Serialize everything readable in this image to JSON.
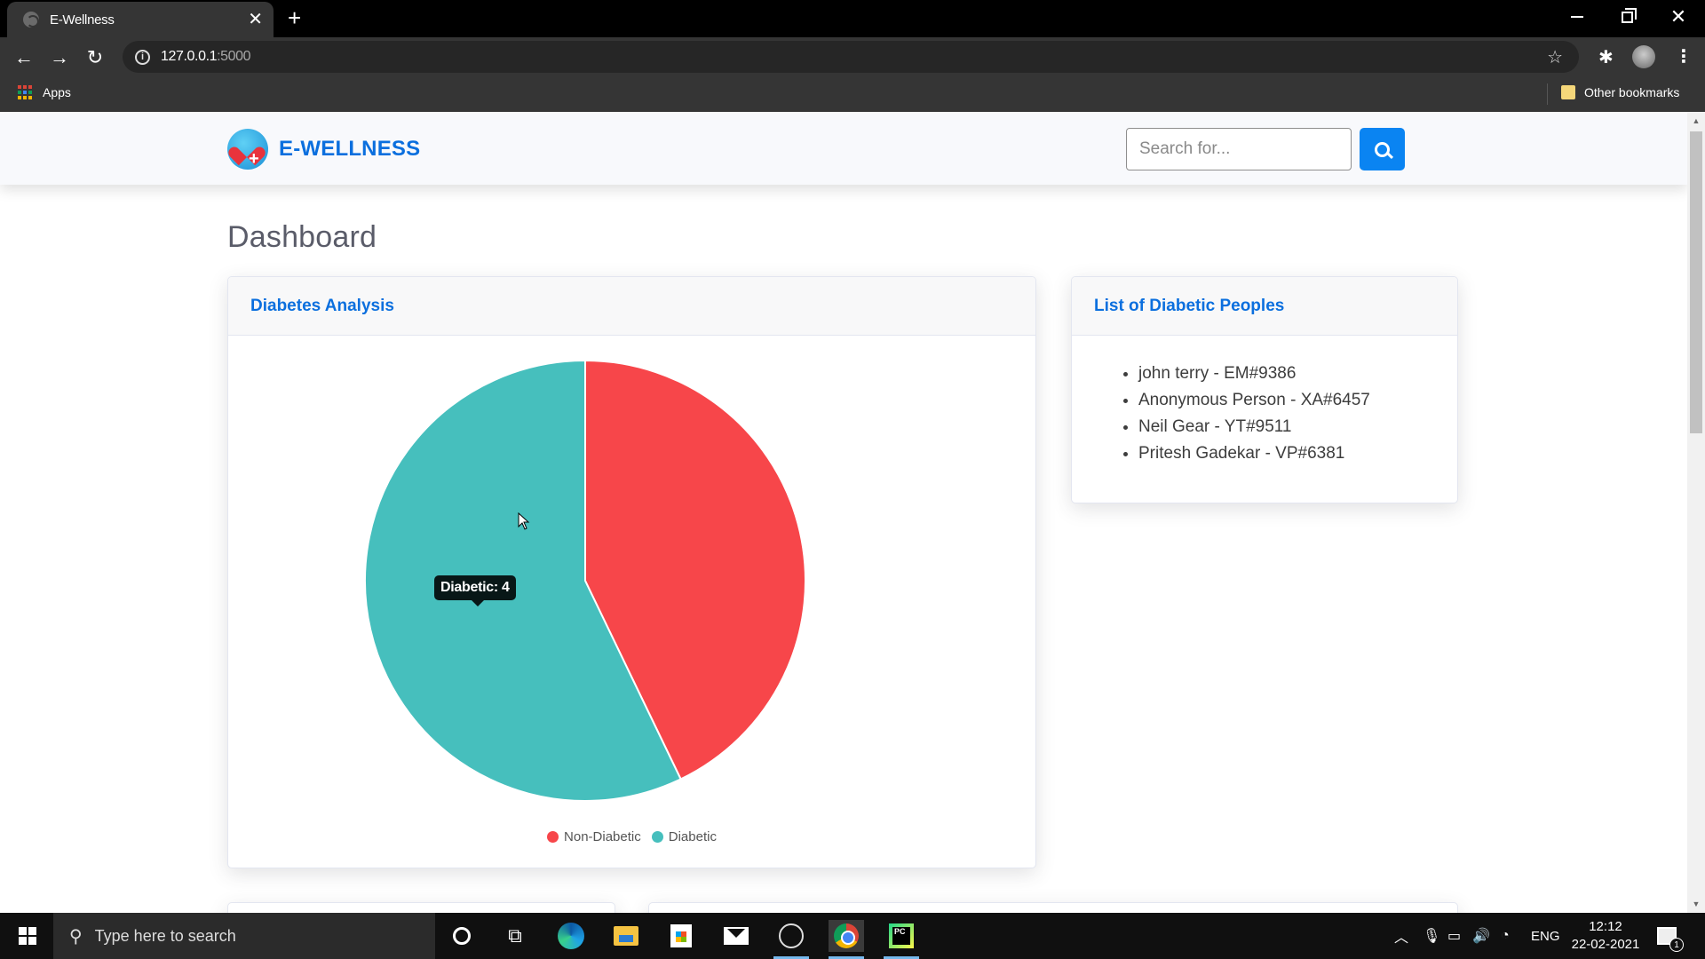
{
  "browser": {
    "tab_title": "E-Wellness",
    "new_tab_symbol": "+",
    "close_tab_symbol": "✕",
    "url_host": "127.0.0.1",
    "url_port": ":5000",
    "bookmarks": {
      "apps_label": "Apps",
      "other_label": "Other bookmarks"
    },
    "icons": {
      "back": "←",
      "forward": "→",
      "reload": "↻",
      "star": "☆",
      "extensions": "✱",
      "menu": "⋮",
      "close_window": "✕"
    }
  },
  "navbar": {
    "brand": "E-WELLNESS",
    "search_placeholder": "Search for...",
    "search_value": ""
  },
  "page": {
    "title": "Dashboard"
  },
  "chart_card": {
    "title": "Diabetes Analysis",
    "tooltip": "Diabetic: 4"
  },
  "chart_data": {
    "type": "pie",
    "title": "Diabetes Analysis",
    "categories": [
      "Non-Diabetic",
      "Diabetic"
    ],
    "values": [
      3,
      4
    ],
    "colors": [
      "#f7464a",
      "#46bfbd"
    ],
    "start_angle": "top, clockwise",
    "legend": "bottom",
    "tooltip": {
      "label": "Diabetic",
      "value": 4
    }
  },
  "list_card": {
    "title": "List of Diabetic Peoples",
    "people": [
      "john terry - EM#9386",
      "Anonymous Person - XA#6457",
      "Neil Gear - YT#9511",
      "Pritesh Gadekar - VP#6381"
    ]
  },
  "taskbar": {
    "search_placeholder": "Type here to search",
    "language": "ENG",
    "time": "12:12",
    "date": "22-02-2021",
    "notification_count": "1",
    "pycharm_label": "PC"
  }
}
